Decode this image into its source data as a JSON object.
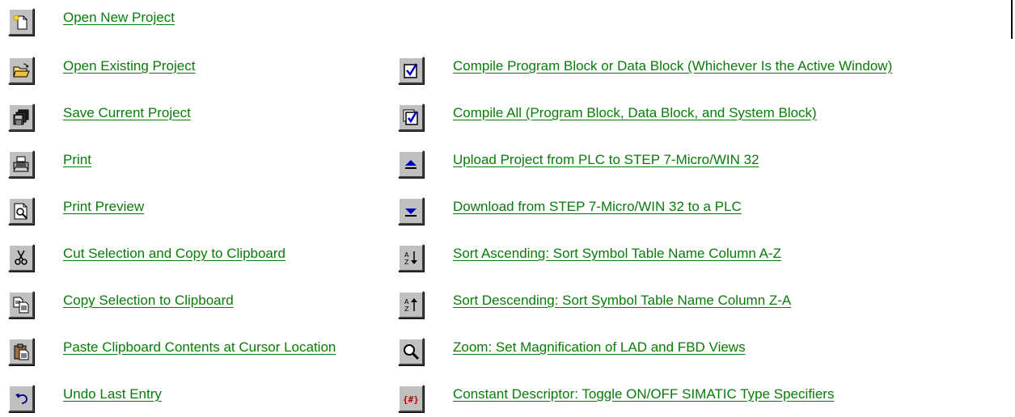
{
  "left_items": [
    {
      "label": "Open New Project",
      "icon": "new-project-icon"
    },
    {
      "label": "Open Existing Project",
      "icon": "open-folder-icon"
    },
    {
      "label": "Save Current Project",
      "icon": "save-icon"
    },
    {
      "label": "Print",
      "icon": "printer-icon"
    },
    {
      "label": "Print Preview",
      "icon": "print-preview-icon"
    },
    {
      "label": "Cut Selection and Copy to Clipboard ",
      "icon": "scissors-icon"
    },
    {
      "label": "Copy Selection to Clipboard",
      "icon": "copy-icon"
    },
    {
      "label": "Paste Clipboard Contents at Cursor Location",
      "icon": "paste-icon"
    },
    {
      "label": "Undo Last Entry",
      "icon": "undo-icon"
    }
  ],
  "right_items": [
    {
      "label": "Compile Program Block or Data Block (Whichever Is the Active Window)",
      "icon": "compile-icon"
    },
    {
      "label": "Compile All (Program Block, Data Block, and System Block)",
      "icon": "compile-all-icon"
    },
    {
      "label": "Upload Project from PLC to STEP 7-Micro/WIN 32",
      "icon": "upload-icon"
    },
    {
      "label": "Download from STEP 7-Micro/WIN 32 to a PLC",
      "icon": "download-icon"
    },
    {
      "label": "Sort Ascending: Sort Symbol Table Name Column A-Z ",
      "icon": "sort-ascending-icon"
    },
    {
      "label": "Sort Descending: Sort Symbol Table Name Column Z-A",
      "icon": "sort-descending-icon"
    },
    {
      "label": "Zoom: Set Magnification of LAD and FBD Views",
      "icon": "zoom-icon"
    },
    {
      "label": "Constant Descriptor: Toggle ON/OFF SIMATIC Type Specifiers",
      "icon": "constant-descriptor-icon"
    }
  ],
  "colors": {
    "link": "#0a7a0a",
    "button_face": "#c0c0c0"
  }
}
